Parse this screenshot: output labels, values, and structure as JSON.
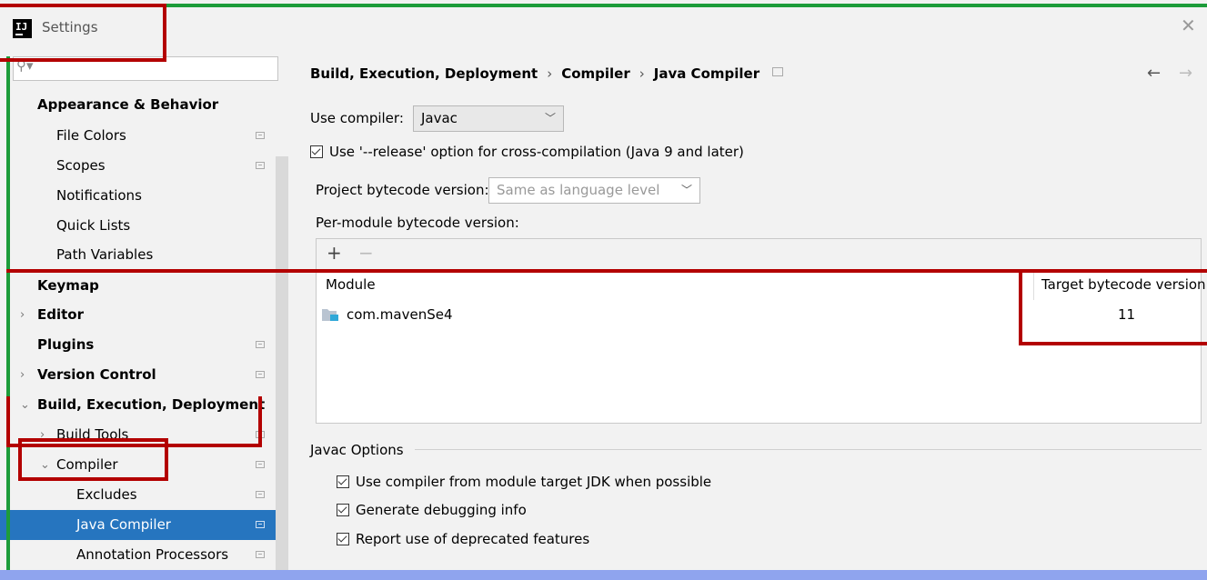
{
  "window": {
    "title": "Settings",
    "logo_text": "IJ"
  },
  "sidebar": {
    "items": [
      {
        "label": "Appearance & Behavior",
        "bold": true
      },
      {
        "label": "File Colors"
      },
      {
        "label": "Scopes"
      },
      {
        "label": "Notifications"
      },
      {
        "label": "Quick Lists"
      },
      {
        "label": "Path Variables"
      },
      {
        "label": "Keymap",
        "bold": true
      },
      {
        "label": "Editor",
        "bold": true
      },
      {
        "label": "Plugins",
        "bold": true
      },
      {
        "label": "Version Control",
        "bold": true
      },
      {
        "label": "Build, Execution, Deployment",
        "bold": true
      },
      {
        "label": "Build Tools"
      },
      {
        "label": "Compiler"
      },
      {
        "label": "Excludes"
      },
      {
        "label": "Java Compiler",
        "selected": true
      },
      {
        "label": "Annotation Processors"
      }
    ]
  },
  "breadcrumb": {
    "parts": [
      "Build, Execution, Deployment",
      "Compiler",
      "Java Compiler"
    ],
    "separator": "›"
  },
  "form": {
    "use_compiler_label": "Use compiler:",
    "use_compiler_value": "Javac",
    "release_option_label": "Use '--release' option for cross-compilation (Java 9 and later)",
    "release_option_checked": true,
    "project_bytecode_label": "Project bytecode version:",
    "project_bytecode_value": "Same as language level",
    "per_module_label": "Per-module bytecode version:"
  },
  "table": {
    "columns": [
      "Module",
      "Target bytecode version"
    ],
    "rows": [
      {
        "module": "com.mavenSe4",
        "target": "11"
      }
    ]
  },
  "javac_options": {
    "title": "Javac Options",
    "options": [
      {
        "label": "Use compiler from module target JDK when possible",
        "checked": true
      },
      {
        "label": "Generate debugging info",
        "checked": true
      },
      {
        "label": "Report use of deprecated features",
        "checked": true
      }
    ]
  },
  "colors": {
    "selection": "#2675bf",
    "annotation_red": "#b30000",
    "annotation_green": "#1d9c3a",
    "bottom_bar": "#8fa4ee"
  }
}
